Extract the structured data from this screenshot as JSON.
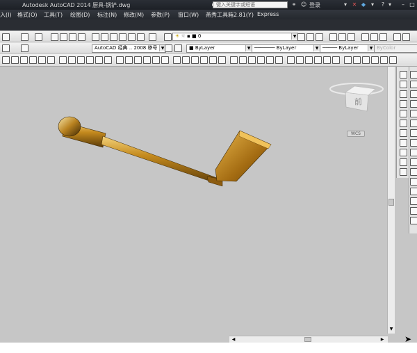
{
  "window": {
    "title": "Autodesk AutoCAD 2014    厨具-锅铲.dwg",
    "search_placeholder": "键入关键字或短语",
    "login_label": "登录",
    "help_label": "?"
  },
  "menu": {
    "items": [
      "入(I)",
      "格式(O)",
      "工具(T)",
      "绘图(D)",
      "标注(N)",
      "修改(M)",
      "参数(P)",
      "窗口(W)",
      "燕秀工具箱2.81(Y)",
      "Express"
    ]
  },
  "layers": {
    "current_layer": "0",
    "text_style": "AutoCAD 经典 .. 2008 移号",
    "color": "ByLayer",
    "linetype": "ByLayer",
    "lineweight": "ByLayer",
    "plot_style": "ByColor"
  },
  "viewport": {
    "ucs_label": "WCS",
    "viewcube_face": "前"
  },
  "colors": {
    "background": "#c6c6c6",
    "spatula": "#b07a18"
  }
}
